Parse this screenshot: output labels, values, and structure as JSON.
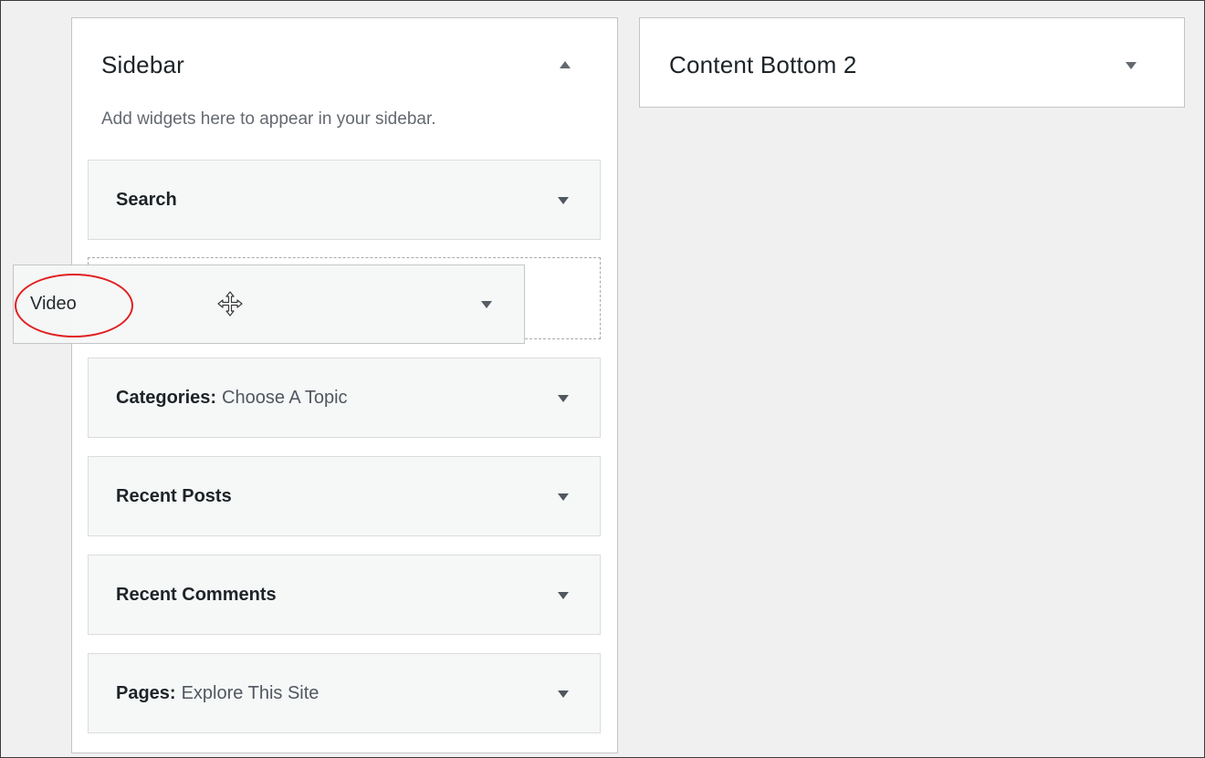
{
  "sidebar_area": {
    "title": "Sidebar",
    "description": "Add widgets here to appear in your sidebar.",
    "toggle_icon": "triangle-up",
    "widgets": [
      {
        "title": "Search",
        "subtitle": ""
      },
      {
        "title": "Categories:",
        "subtitle": "Choose A Topic"
      },
      {
        "title": "Recent Posts",
        "subtitle": ""
      },
      {
        "title": "Recent Comments",
        "subtitle": ""
      },
      {
        "title": "Pages:",
        "subtitle": "Explore This Site"
      }
    ]
  },
  "content_bottom_2_area": {
    "title": "Content Bottom 2",
    "toggle_icon": "triangle-down"
  },
  "dragged_widget": {
    "title": "Video",
    "cursor_icon": "move-cursor-icon",
    "highlight_color": "#e02020"
  },
  "colors": {
    "background": "#f0f0f1",
    "panel": "#ffffff",
    "widget": "#f6f7f7",
    "border": "#c3c4c7",
    "muted_text": "#646970"
  }
}
